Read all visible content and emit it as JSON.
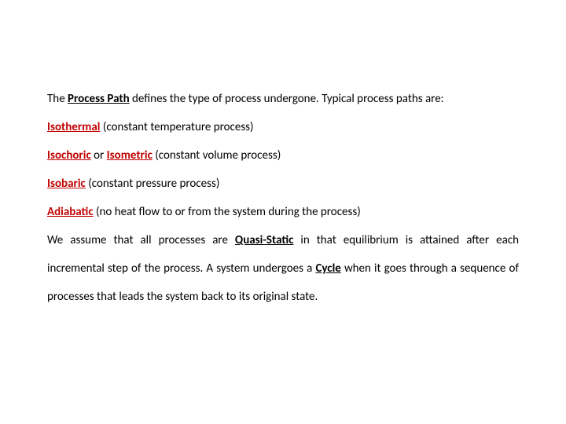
{
  "body": {
    "intro_prefix": "The ",
    "process_path": "Process Path",
    "intro_suffix": " defines the type of process undergone. Typical process paths are:",
    "items": [
      {
        "term": "Isothermal",
        "desc": " (constant temperature process)"
      },
      {
        "term": "Isochoric",
        "or": " or ",
        "term2": "Isometric",
        "desc": " (constant volume process)"
      },
      {
        "term": "Isobaric",
        "desc": " (constant pressure process)"
      },
      {
        "term": "Adiabatic",
        "desc": " (no heat flow to or from the system during the process)"
      }
    ],
    "closing_a": "We assume that all processes are ",
    "quasi_static": "Quasi-Static",
    "closing_b": " in that equilibrium is attained after each incremental step of the process. A system undergoes a ",
    "cycle": "Cycle",
    "closing_c": " when it goes through a sequence of processes that leads the system back to its original state."
  }
}
